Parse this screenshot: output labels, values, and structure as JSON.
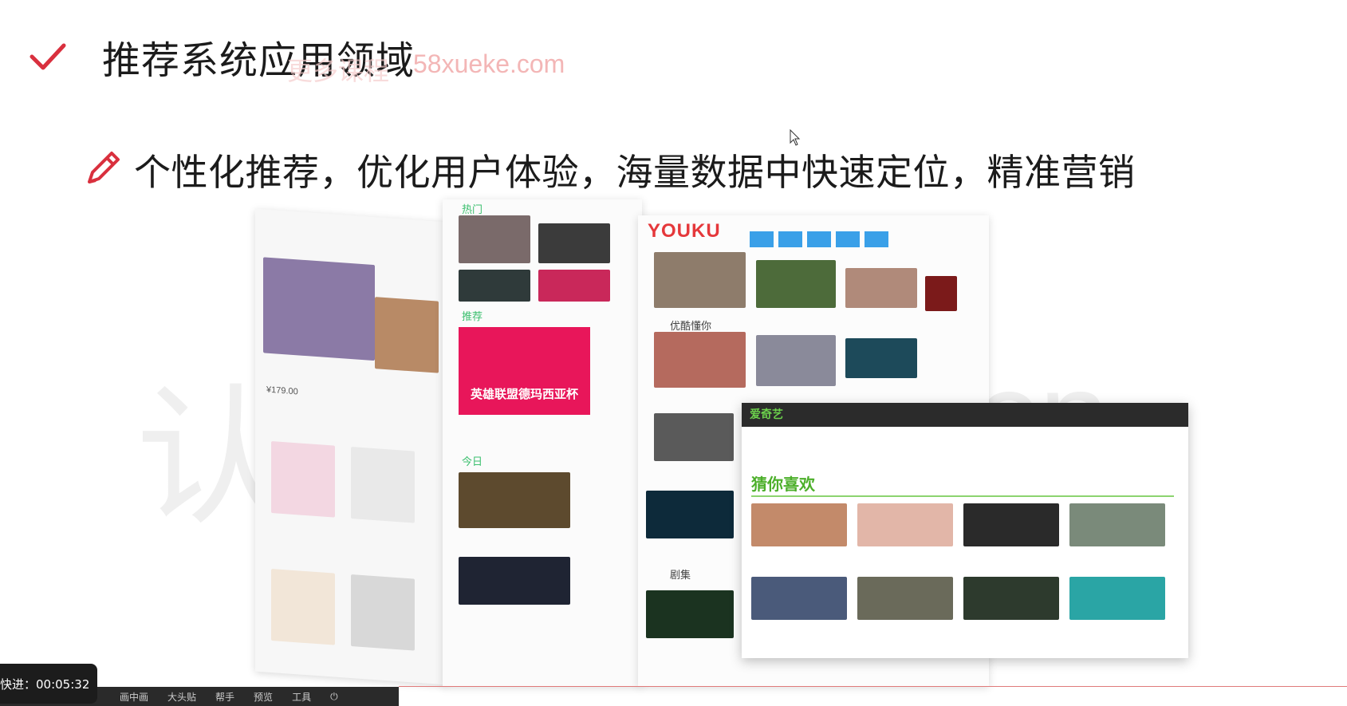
{
  "slide": {
    "title": "推荐系统应用领域",
    "site_mark": "58xueke.com",
    "site_mark_faint": "更多课程",
    "bullet": "个性化推荐，优化用户体验，海量数据中快速定位，精准营销"
  },
  "collage": {
    "youku_logo": "YOUKU",
    "hot_label": "热门",
    "recommend_label": "推荐",
    "today_label": "今日",
    "banner_text": "英雄联盟德玛西亚杯",
    "youlike_label": "优酷懂你",
    "guess_label": "猜你喜欢",
    "iqiyi_logo": "爱奇艺",
    "drama_label": "剧集",
    "price_label": "¥179.00"
  },
  "watermark": {
    "cn": "认准",
    "latin": "v.cn"
  },
  "player": {
    "osd_text": "快进：00:05:32",
    "toolbar": [
      "画中画",
      "大头贴",
      "帮手",
      "预览",
      "工具"
    ]
  },
  "colors": {
    "accent_red": "#d9303e",
    "youku_red": "#e5383b",
    "iqiyi_green": "#4caf2a",
    "banner_pink": "#e8165a"
  }
}
